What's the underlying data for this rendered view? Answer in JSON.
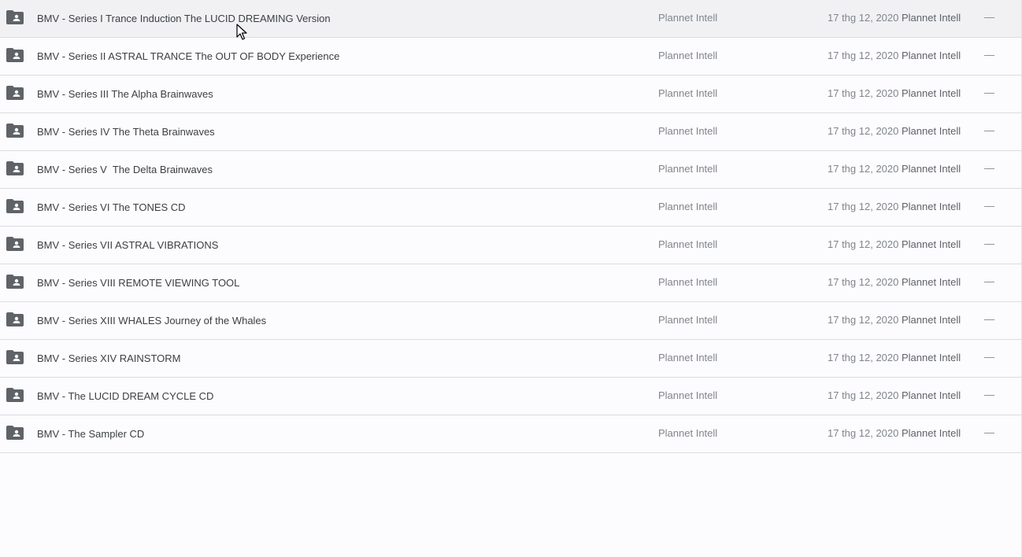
{
  "file_list": {
    "rows": [
      {
        "name": "BMV - Series I Trance Induction The LUCID DREAMING Version",
        "owner": "Plannet Intell",
        "date": "17 thg 12, 2020",
        "modifier": "Plannet Intell",
        "size": "—",
        "icon": "shared-folder-icon"
      },
      {
        "name": "BMV - Series II ASTRAL TRANCE The OUT OF BODY Experience",
        "owner": "Plannet Intell",
        "date": "17 thg 12, 2020",
        "modifier": "Plannet Intell",
        "size": "—",
        "icon": "shared-folder-icon"
      },
      {
        "name": "BMV - Series III The Alpha Brainwaves",
        "owner": "Plannet Intell",
        "date": "17 thg 12, 2020",
        "modifier": "Plannet Intell",
        "size": "—",
        "icon": "shared-folder-icon"
      },
      {
        "name": "BMV - Series IV The Theta Brainwaves",
        "owner": "Plannet Intell",
        "date": "17 thg 12, 2020",
        "modifier": "Plannet Intell",
        "size": "—",
        "icon": "shared-folder-icon"
      },
      {
        "name": "BMV - Series V  The Delta Brainwaves",
        "owner": "Plannet Intell",
        "date": "17 thg 12, 2020",
        "modifier": "Plannet Intell",
        "size": "—",
        "icon": "shared-folder-icon"
      },
      {
        "name": "BMV - Series VI The TONES CD",
        "owner": "Plannet Intell",
        "date": "17 thg 12, 2020",
        "modifier": "Plannet Intell",
        "size": "—",
        "icon": "shared-folder-icon"
      },
      {
        "name": "BMV - Series VII ASTRAL VIBRATIONS",
        "owner": "Plannet Intell",
        "date": "17 thg 12, 2020",
        "modifier": "Plannet Intell",
        "size": "—",
        "icon": "shared-folder-icon"
      },
      {
        "name": "BMV - Series VIII REMOTE VIEWING TOOL",
        "owner": "Plannet Intell",
        "date": "17 thg 12, 2020",
        "modifier": "Plannet Intell",
        "size": "—",
        "icon": "shared-folder-icon"
      },
      {
        "name": "BMV - Series XIII WHALES Journey of the Whales",
        "owner": "Plannet Intell",
        "date": "17 thg 12, 2020",
        "modifier": "Plannet Intell",
        "size": "—",
        "icon": "shared-folder-icon"
      },
      {
        "name": "BMV - Series XIV RAINSTORM",
        "owner": "Plannet Intell",
        "date": "17 thg 12, 2020",
        "modifier": "Plannet Intell",
        "size": "—",
        "icon": "shared-folder-icon"
      },
      {
        "name": "BMV - The LUCID DREAM CYCLE CD",
        "owner": "Plannet Intell",
        "date": "17 thg 12, 2020",
        "modifier": "Plannet Intell",
        "size": "—",
        "icon": "shared-folder-icon"
      },
      {
        "name": "BMV - The Sampler CD",
        "owner": "Plannet Intell",
        "date": "17 thg 12, 2020",
        "modifier": "Plannet Intell",
        "size": "—",
        "icon": "shared-folder-icon"
      }
    ]
  },
  "colors": {
    "folder_icon": "#5f6368",
    "background": "#fcfbfd",
    "row_divider": "#dcdcdf"
  }
}
